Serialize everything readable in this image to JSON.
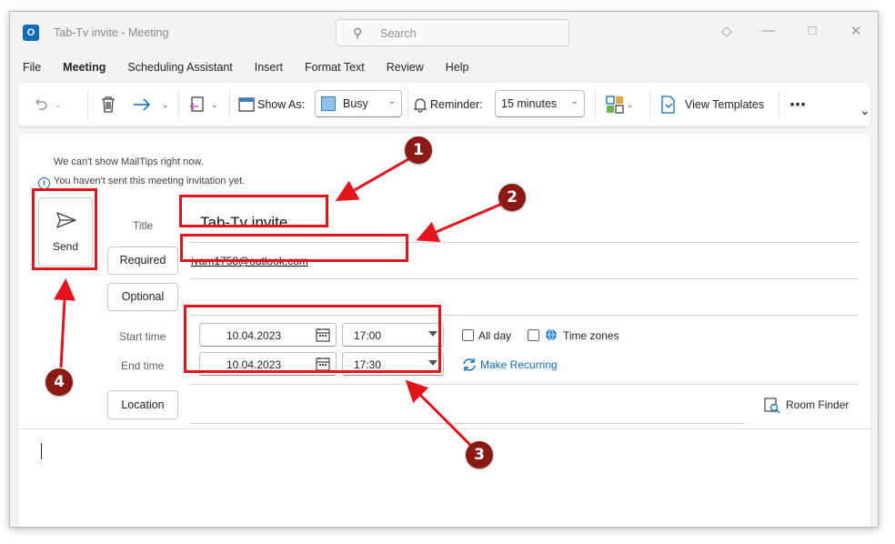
{
  "titlebar": {
    "app_icon": "outlook-icon",
    "title": "Tab-Tv invite  -  Meeting",
    "search_placeholder": "Search",
    "controls": [
      "diamond-icon",
      "minimize-icon",
      "maximize-icon",
      "close-icon"
    ]
  },
  "menu": {
    "tabs": [
      "File",
      "Meeting",
      "Scheduling Assistant",
      "Insert",
      "Format Text",
      "Review",
      "Help"
    ],
    "active": "Meeting"
  },
  "ribbon": {
    "show_as_label": "Show As:",
    "show_as_value": "Busy",
    "reminder_label": "Reminder:",
    "reminder_value": "15 minutes",
    "view_templates": "View Templates",
    "more": "⋯",
    "expand": "⌄"
  },
  "form": {
    "mailtip_line1": "We can't show MailTips right now.",
    "mailtip_line2": "You haven't sent this meeting invitation yet.",
    "send_label": "Send",
    "title_label": "Title",
    "title_value": "Tab-Tv invite",
    "required_label": "Required",
    "required_value": "ivam1758@outlook.com",
    "optional_label": "Optional",
    "start_label": "Start time",
    "end_label": "End time",
    "start_date": "10.04.2023",
    "start_time": "17:00",
    "end_date": "10.04.2023",
    "end_time": "17:30",
    "all_day": "All day",
    "time_zones": "Time zones",
    "make_recurring": "Make Recurring",
    "location_label": "Location",
    "room_finder": "Room Finder"
  },
  "annotations": [
    "1",
    "2",
    "3",
    "4"
  ],
  "colors": {
    "accent": "#0f6cbd",
    "annotation_red": "#e3141c",
    "badge_fill": "#8b1a14",
    "busy": "#8fc2ea"
  }
}
